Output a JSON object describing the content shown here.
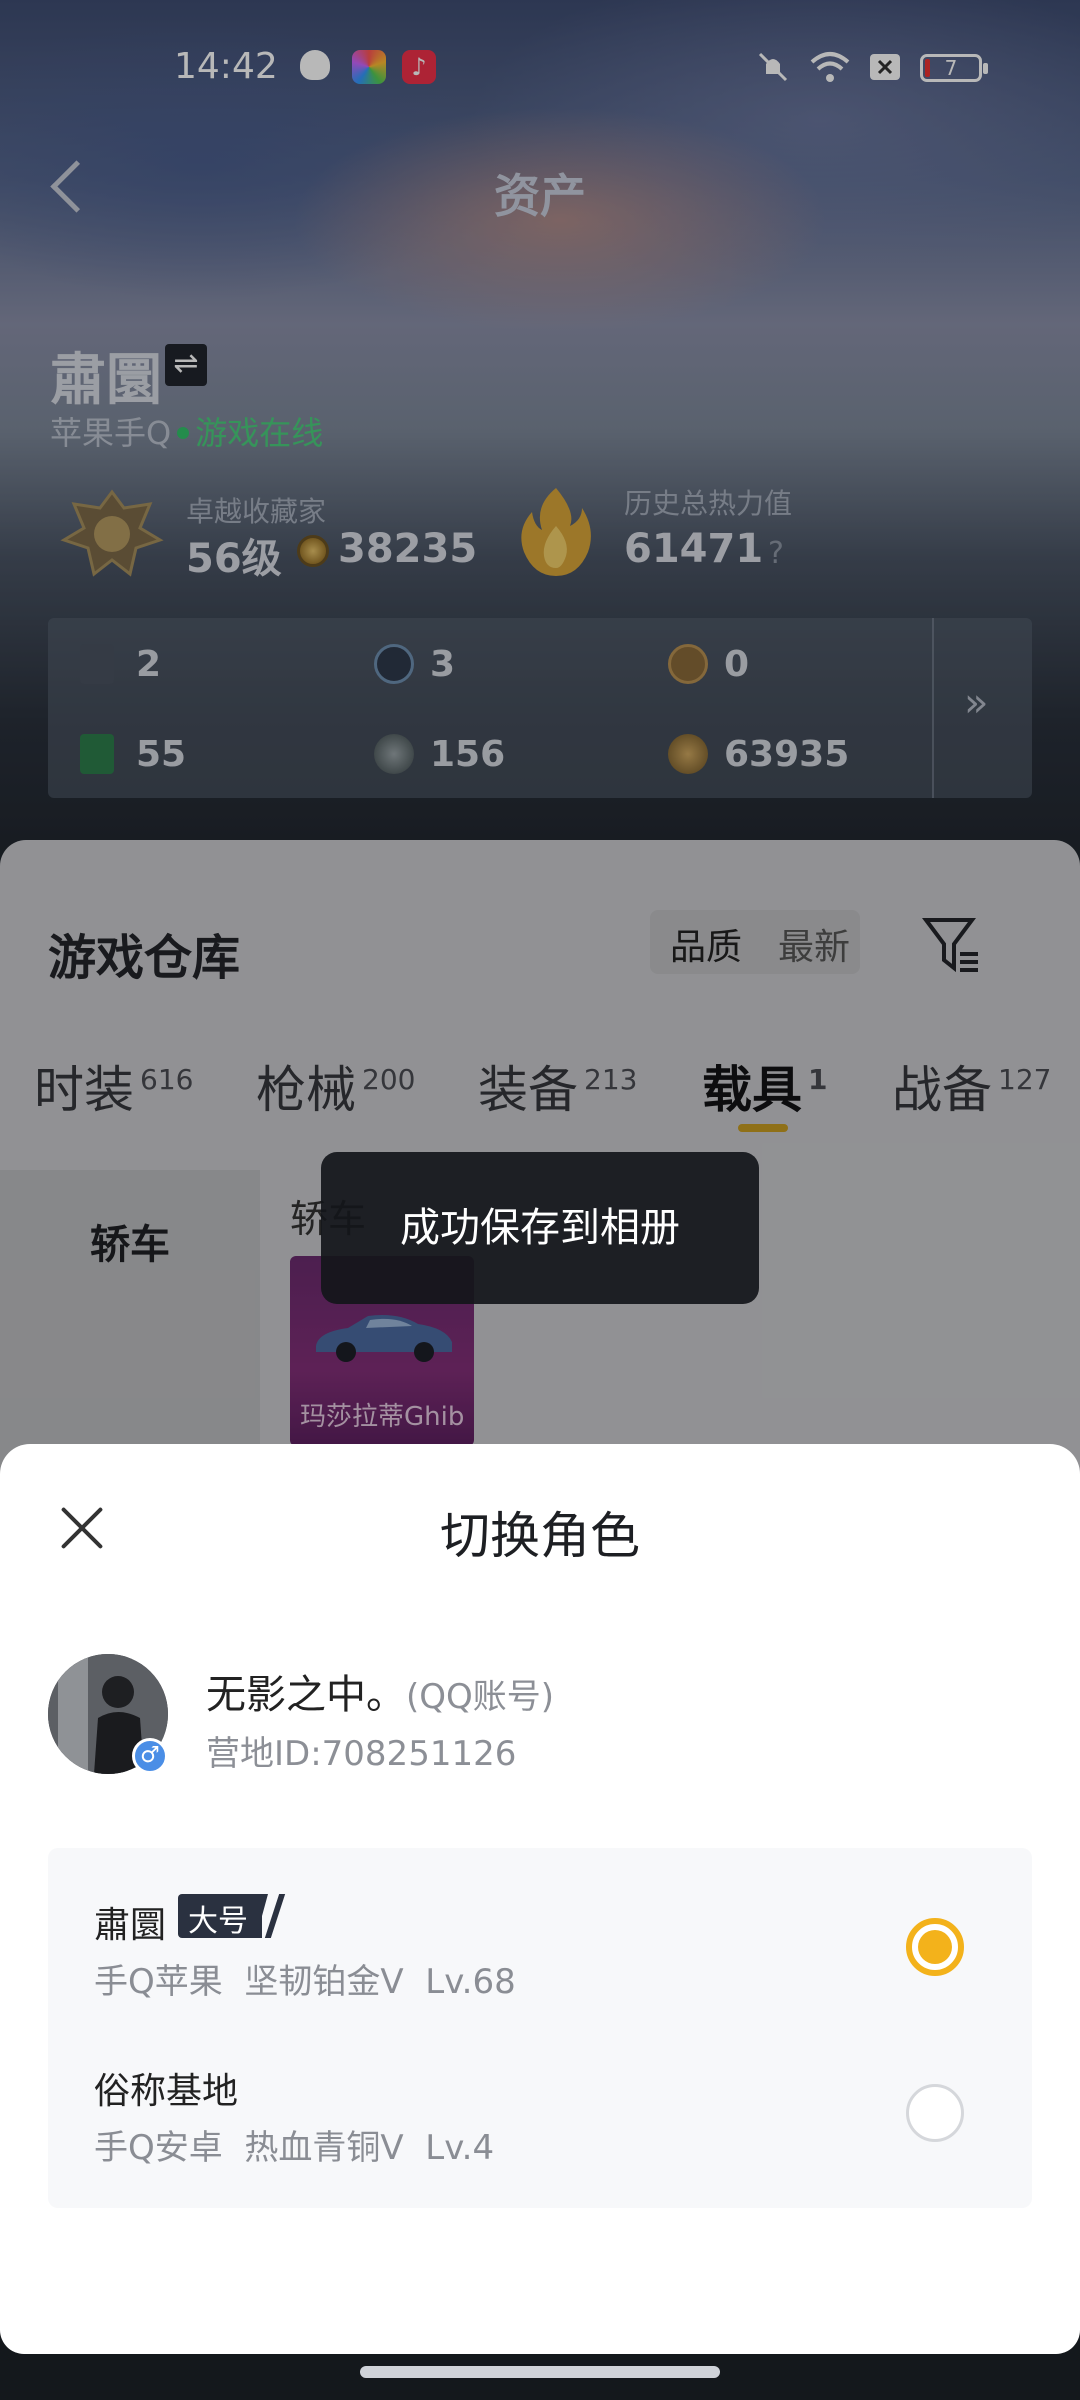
{
  "status_bar": {
    "time": "14:42",
    "battery": "7",
    "icons": [
      "shield-app-icon",
      "photos-app-icon",
      "music-app-icon",
      "mute-icon",
      "wifi-icon",
      "close-box-icon",
      "battery-icon"
    ]
  },
  "header": {
    "title": "资产"
  },
  "profile": {
    "nickname": "肅圜",
    "switch_icon": "⇌",
    "platform": "苹果手Q",
    "online_status": "游戏在线"
  },
  "stats": {
    "collector_label": "卓越收藏家",
    "collector_level": "56级",
    "collector_coins": "38235",
    "heat_label": "历史总热力值",
    "heat_value": "61471",
    "help": "?"
  },
  "assets": {
    "items": [
      "2",
      "3",
      "0",
      "55",
      "156",
      "63935"
    ],
    "more": "»"
  },
  "warehouse": {
    "title": "游戏仓库",
    "sort_quality": "品质",
    "sort_newest": "最新",
    "tabs": [
      {
        "label": "时装",
        "count": "616"
      },
      {
        "label": "枪械",
        "count": "200"
      },
      {
        "label": "装备",
        "count": "213"
      },
      {
        "label": "载具",
        "count": "1"
      },
      {
        "label": "战备",
        "count": "127"
      }
    ],
    "active_tab": "载具",
    "category": "轿车",
    "subcategory": "轿车",
    "vehicle_name": "玛莎拉蒂Ghib"
  },
  "toast": {
    "message": "成功保存到相册"
  },
  "sheet": {
    "title": "切换角色",
    "account_name": "无影之中。",
    "account_type": "(QQ账号)",
    "camp_id": "营地ID:708251126",
    "gender_symbol": "♂",
    "roles": [
      {
        "name": "肅圜",
        "badge": "大号",
        "detail": "手Q苹果  坚韧铂金V  Lv.68",
        "selected": true
      },
      {
        "name": "俗称基地",
        "badge": "",
        "detail": "手Q安卓  热血青铜V  Lv.4",
        "selected": false
      }
    ]
  },
  "colors": {
    "accent": "#f3b21b",
    "online": "#4ccd7d",
    "tab_underline": "#c79b22"
  }
}
